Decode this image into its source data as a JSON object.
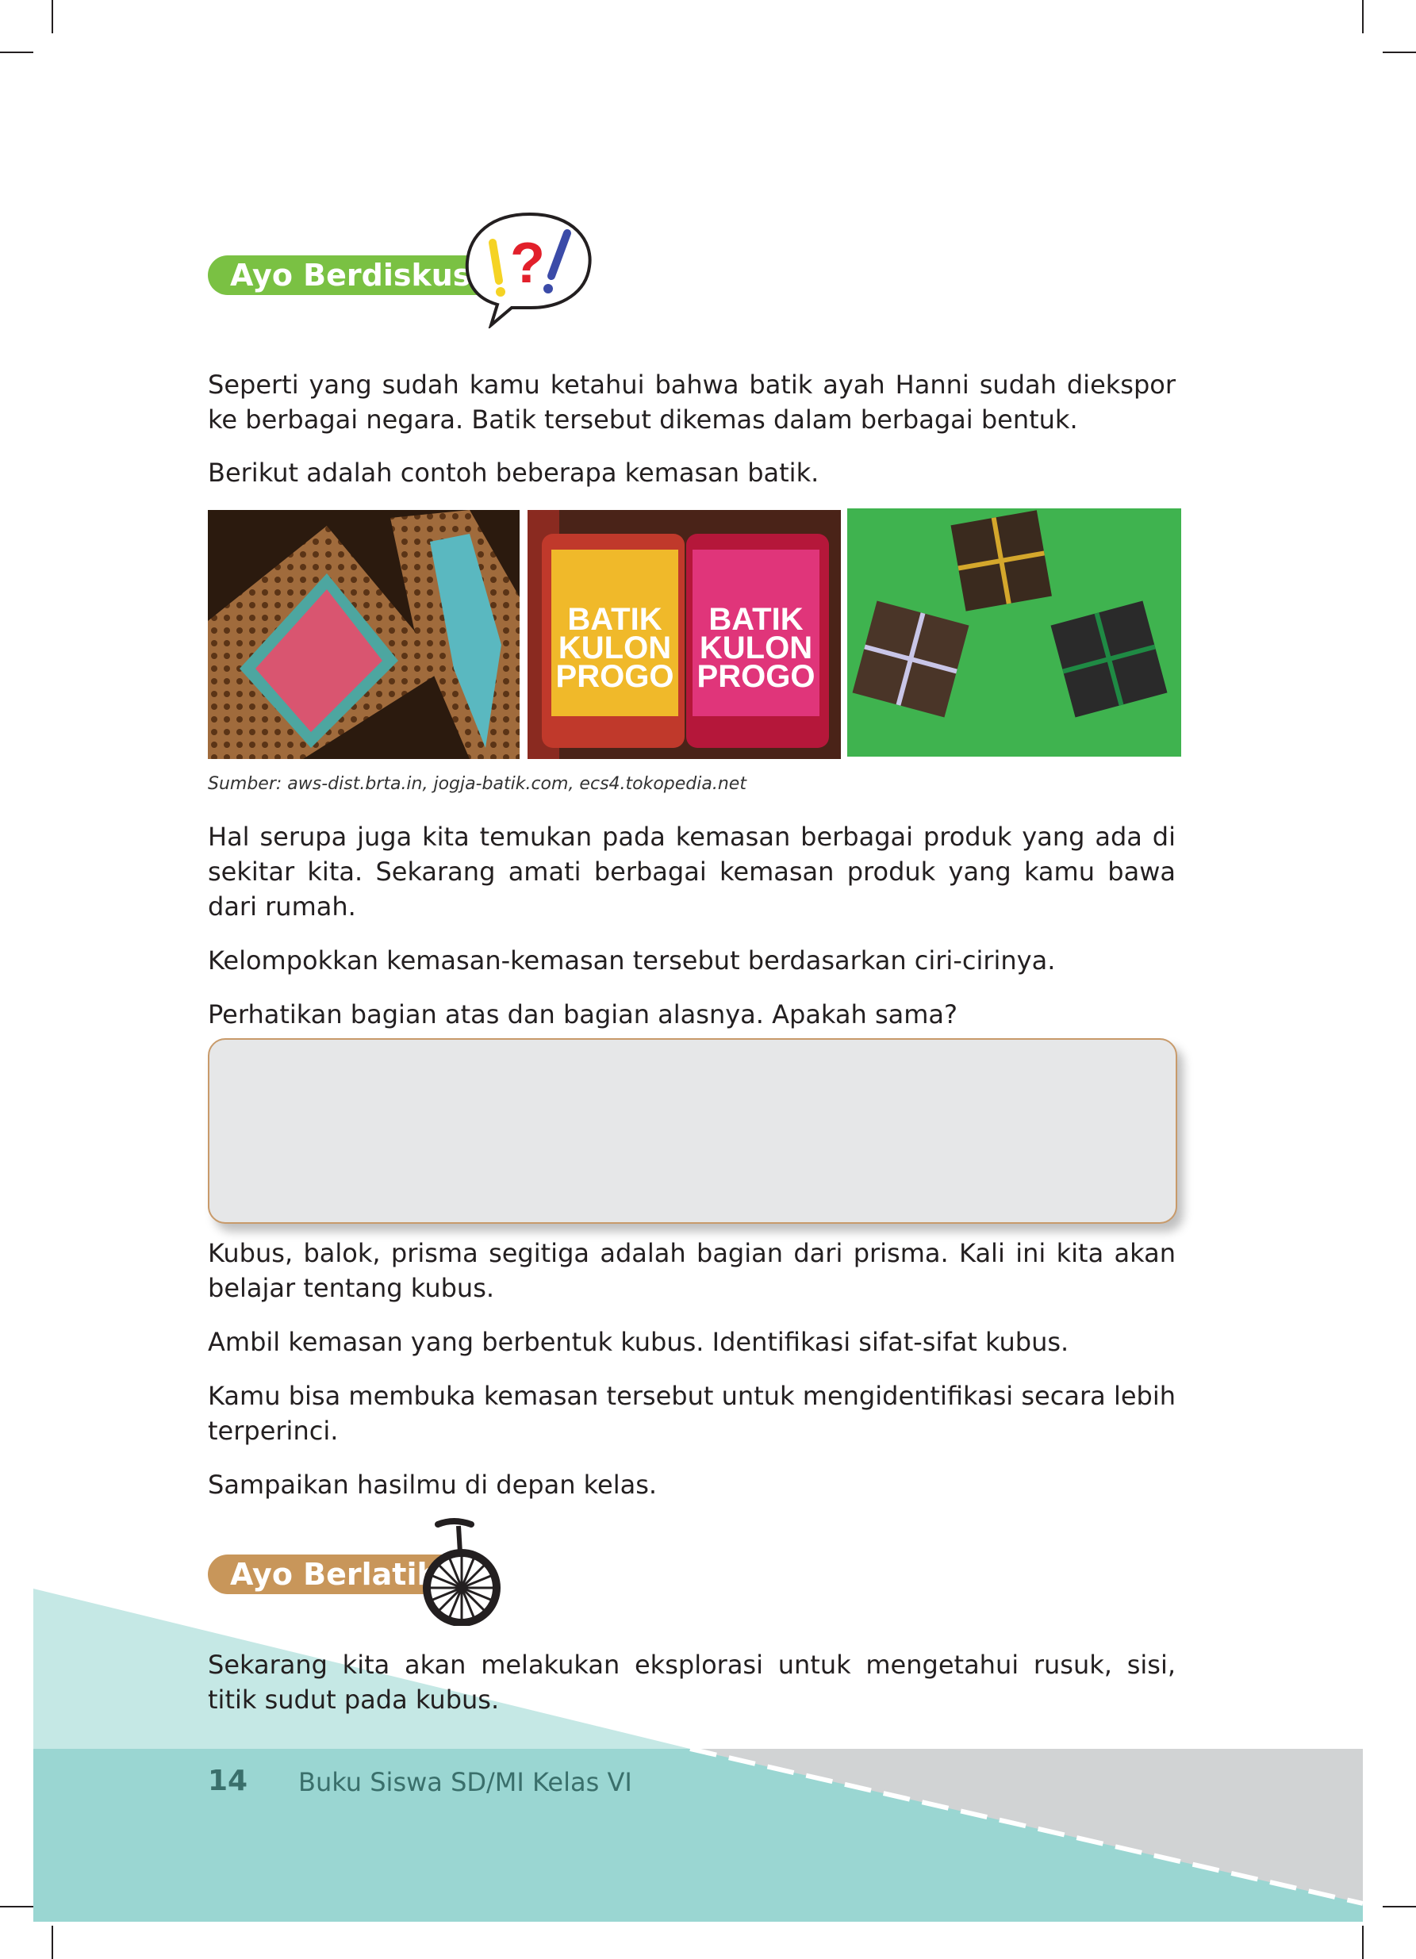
{
  "sections": {
    "discussion": {
      "title": "Ayo Berdiskusi",
      "icon": "question-exclamation-bubble-icon"
    },
    "practice": {
      "title": "Ayo Berlatih",
      "icon": "unicycle-icon"
    }
  },
  "paragraphs": {
    "p1": "Seperti yang sudah kamu ketahui bahwa batik ayah Hanni sudah diekspor ke berbagai negara. Batik tersebut dikemas dalam berbagai bentuk.",
    "p2": "Berikut adalah contoh beberapa kemasan batik.",
    "p3": "Hal serupa juga kita temukan pada kemasan berbagai produk yang ada di sekitar kita. Sekarang amati berbagai kemasan produk yang kamu bawa dari rumah.",
    "p4": "Kelompokkan kemasan-kemasan tersebut berdasarkan ciri-cirinya.",
    "p5": "Perhatikan bagian atas dan bagian alasnya. Apakah sama?",
    "p6": "Kubus, balok, prisma segitiga adalah bagian dari prisma. Kali ini kita akan belajar tentang kubus.",
    "p7": "Ambil kemasan yang berbentuk kubus. Identifikasi sifat-sifat kubus.",
    "p8": "Kamu bisa membuka kemasan tersebut untuk mengidentifikasi secara lebih terperinci.",
    "p9": "Sampaikan hasilmu di depan kelas.",
    "p10": "Sekarang kita akan melakukan eksplorasi untuk mengetahui rusuk, sisi, titik sudut pada kubus."
  },
  "images": {
    "caption": "Sumber: aws-dist.brta.in, jogja-batik.com, ecs4.tokopedia.net",
    "tube_label_line1": "BATIK",
    "tube_label_line2": "KULON",
    "tube_label_line3": "PROGO"
  },
  "footer": {
    "page_number": "14",
    "book_title": "Buku Siswa SD/MI Kelas VI"
  },
  "colors": {
    "discussion_green": "#7ac143",
    "practice_tan": "#c8965a",
    "teal_band": "#9ad6d2",
    "light_teal": "#c5e8e5",
    "gray_band": "#d1d3d4",
    "text": "#231f20"
  }
}
